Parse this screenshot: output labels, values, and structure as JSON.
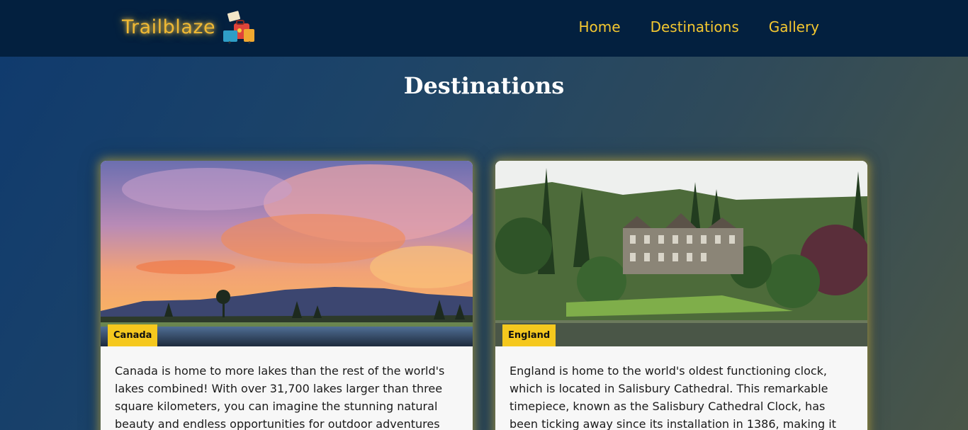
{
  "brand": {
    "name": "Trailblaze",
    "icon": "travel-luggage-icon"
  },
  "nav": {
    "items": [
      {
        "label": "Home"
      },
      {
        "label": "Destinations"
      },
      {
        "label": "Gallery"
      }
    ]
  },
  "page": {
    "title": "Destinations"
  },
  "cards": [
    {
      "tag": "Canada",
      "image": "sunset-lake-mountains-photo",
      "text": "Canada is home to more lakes than the rest of the world's lakes combined! With over 31,700 lakes larger than three square kilometers, you can imagine the stunning natural beauty and endless opportunities for outdoor adventures"
    },
    {
      "tag": "England",
      "image": "manor-house-lake-forest-photo",
      "text": "England is home to the world's oldest functioning clock, which is located in Salisbury Cathedral. This remarkable timepiece, known as the Salisbury Cathedral Clock, has been ticking away since its installation in 1386, making it"
    }
  ],
  "colors": {
    "navbar": "#03203f",
    "accent": "#f5c830",
    "tag": "#f5c81e"
  }
}
